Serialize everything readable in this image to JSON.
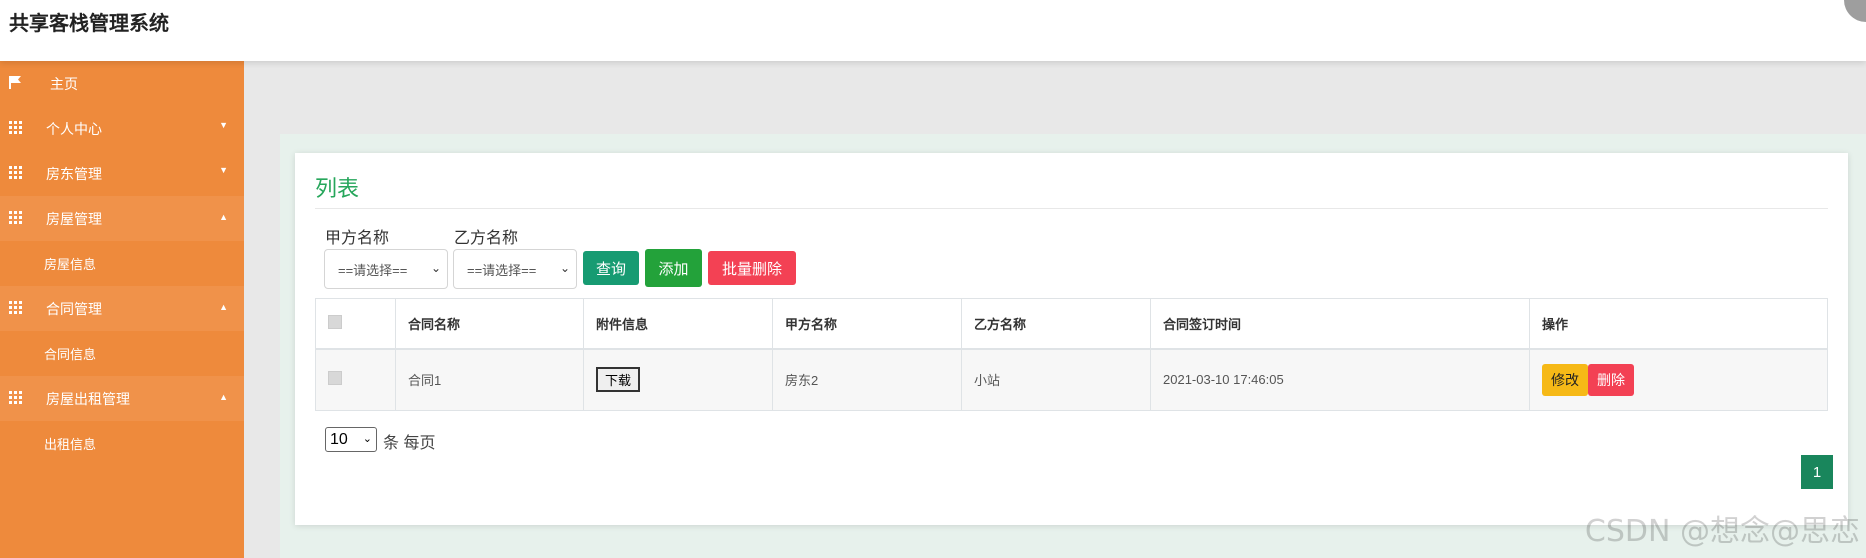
{
  "app": {
    "title": "共享客栈管理系统"
  },
  "sidebar": {
    "items": [
      {
        "label": "主页",
        "icon": "flag-icon"
      },
      {
        "label": "个人中心",
        "icon": "grid-icon",
        "expanded": false
      },
      {
        "label": "房东管理",
        "icon": "grid-icon",
        "expanded": false
      },
      {
        "label": "房屋管理",
        "icon": "grid-icon",
        "expanded": true,
        "children": [
          "房屋信息"
        ]
      },
      {
        "label": "合同管理",
        "icon": "grid-icon",
        "expanded": true,
        "children": [
          "合同信息"
        ]
      },
      {
        "label": "房屋出租管理",
        "icon": "grid-icon",
        "expanded": true,
        "children": [
          "出租信息"
        ]
      }
    ]
  },
  "main": {
    "title": "列表",
    "filters": [
      {
        "label": "甲方名称",
        "value": "==请选择=="
      },
      {
        "label": "乙方名称",
        "value": "==请选择=="
      }
    ],
    "buttons": {
      "search": "查询",
      "add": "添加",
      "batch_delete": "批量删除"
    },
    "table": {
      "columns": [
        "合同名称",
        "附件信息",
        "甲方名称",
        "乙方名称",
        "合同签订时间",
        "操作"
      ],
      "rows": [
        {
          "contract_name": "合同1",
          "attachment": "下载",
          "party_a": "房东2",
          "party_b": "小站",
          "signed_time": "2021-03-10 17:46:05",
          "edit": "修改",
          "delete": "删除"
        }
      ]
    },
    "pagination": {
      "page_size": "10",
      "per_page_label": "条 每页",
      "current_page": "1"
    }
  },
  "watermark": "CSDN @想念@思恋",
  "colors": {
    "sidebar": "#ee8a3c",
    "title_green": "#26a65b",
    "search": "#179b72",
    "add": "#23a23a",
    "danger": "#f34154",
    "warning": "#f6b917",
    "page": "#19865c"
  }
}
